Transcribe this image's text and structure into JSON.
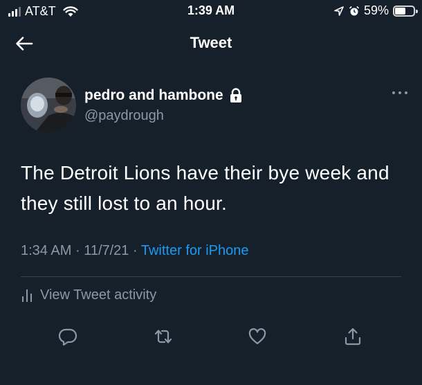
{
  "status_bar": {
    "carrier": "AT&T",
    "time": "1:39 AM",
    "battery_percent_label": "59%",
    "battery_level": 0.59,
    "signal_bars": 3
  },
  "nav": {
    "title": "Tweet"
  },
  "tweet": {
    "author": {
      "display_name": "pedro and hambone",
      "handle": "@paydrough",
      "protected": true
    },
    "text": "The Detroit Lions have their bye week and they still lost to an hour.",
    "time": "1:34 AM",
    "separator": "·",
    "date": "11/7/21",
    "source": "Twitter for iPhone"
  },
  "activity": {
    "label": "View Tweet activity"
  },
  "actions": [
    "reply-icon",
    "retweet-icon",
    "like-icon",
    "share-icon"
  ],
  "colors": {
    "background": "#15202b",
    "text_primary": "#ffffff",
    "text_secondary": "#8b98a5",
    "accent": "#1d9bf0",
    "divider": "#38444d"
  }
}
